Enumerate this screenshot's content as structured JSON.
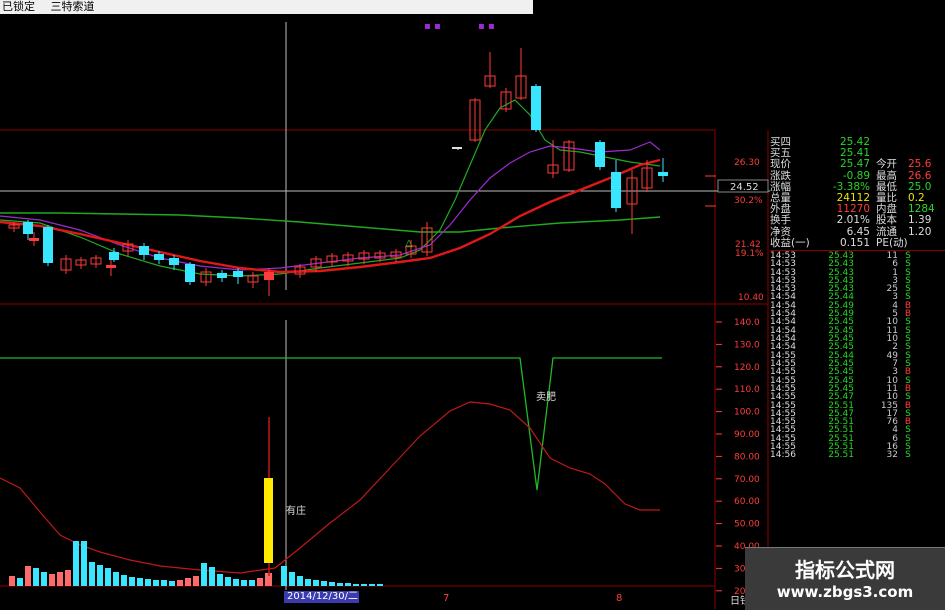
{
  "titlebar": {
    "locked": "已锁定",
    "feature": "三特索道"
  },
  "price_axis": {
    "p1": "26.30",
    "p2": "21.42",
    "p3": "19.1%",
    "p4": "10.40",
    "current": "24.52",
    "pct_hi": "30.2%"
  },
  "indicator_axis": [
    "140.0",
    "130.0",
    "120.0",
    "110.0",
    "100.0",
    "90.00",
    "80.00",
    "70.00",
    "60.00",
    "50.00",
    "40.00",
    "30.00",
    "20.00"
  ],
  "annotations": {
    "sell": "卖肥",
    "buy": "有庄"
  },
  "bottom_date": "2014/12/30/二",
  "bottom_marks": [
    "7",
    "8"
  ],
  "bottom_tab": "日钱",
  "quote_panel": {
    "rows": [
      {
        "l1": "买四",
        "v1": "25.42",
        "c1": "grn"
      },
      {
        "l1": "买五",
        "v1": "25.41",
        "c1": "grn"
      },
      {
        "l1": "现价",
        "v1": "25.47",
        "c1": "grn",
        "l2": "今开",
        "v2": "25.6",
        "c2": "red"
      },
      {
        "l1": "涨跌",
        "v1": "-0.89",
        "c1": "grn",
        "l2": "最高",
        "v2": "26.6",
        "c2": "red"
      },
      {
        "l1": "涨幅",
        "v1": "-3.38%",
        "c1": "grn",
        "l2": "最低",
        "v2": "25.0",
        "c2": "grn"
      },
      {
        "l1": "总量",
        "v1": "24112",
        "c1": "yel",
        "l2": "量比",
        "v2": "0.2",
        "c2": "yel"
      },
      {
        "l1": "外盘",
        "v1": "11270",
        "c1": "red",
        "l2": "内盘",
        "v2": "1284",
        "c2": "grn"
      },
      {
        "l1": "换手",
        "v1": "2.01%",
        "c1": "wht",
        "l2": "股本",
        "v2": "1.39",
        "c2": "wht"
      },
      {
        "l1": "净资",
        "v1": "6.45",
        "c1": "wht",
        "l2": "流通",
        "v2": "1.20",
        "c2": "wht"
      },
      {
        "l1": "收益(一)",
        "v1": "0.151",
        "c1": "wht",
        "l2": "PE(动)",
        "v2": "",
        "c2": "wht"
      }
    ],
    "ticks": [
      [
        "14:53",
        "25.43",
        "11",
        "S"
      ],
      [
        "14:53",
        "25.43",
        "6",
        "S"
      ],
      [
        "14:53",
        "25.43",
        "1",
        "S"
      ],
      [
        "14:53",
        "25.43",
        "3",
        "S"
      ],
      [
        "14:53",
        "25.43",
        "25",
        "S"
      ],
      [
        "14:54",
        "25.44",
        "3",
        "S"
      ],
      [
        "14:54",
        "25.49",
        "4",
        "B"
      ],
      [
        "14:54",
        "25.49",
        "5",
        "B"
      ],
      [
        "14:54",
        "25.45",
        "10",
        "S"
      ],
      [
        "14:54",
        "25.45",
        "11",
        "S"
      ],
      [
        "14:54",
        "25.45",
        "10",
        "S"
      ],
      [
        "14:54",
        "25.45",
        "2",
        "S"
      ],
      [
        "14:55",
        "25.44",
        "49",
        "S"
      ],
      [
        "14:55",
        "25.45",
        "7",
        "S"
      ],
      [
        "14:55",
        "25.45",
        "3",
        "B"
      ],
      [
        "14:55",
        "25.45",
        "10",
        "S"
      ],
      [
        "14:55",
        "25.45",
        "11",
        "B"
      ],
      [
        "14:55",
        "25.47",
        "10",
        "S"
      ],
      [
        "14:55",
        "25.51",
        "135",
        "B"
      ],
      [
        "14:55",
        "25.47",
        "17",
        "S"
      ],
      [
        "14:55",
        "25.51",
        "76",
        "B"
      ],
      [
        "14:55",
        "25.51",
        "4",
        "S"
      ],
      [
        "14:55",
        "25.51",
        "6",
        "S"
      ],
      [
        "14:55",
        "25.51",
        "16",
        "S"
      ],
      [
        "14:56",
        "25.51",
        "32",
        "S"
      ]
    ]
  },
  "watermark": {
    "line1": "指标公式网",
    "line2": "www.zbgs3.com"
  },
  "colors": {
    "up": "#ff3b3b",
    "down": "#38e6ff",
    "ma_red": "#e01818",
    "ma_green": "#1faa1f",
    "ma_purple": "#9d2bd1",
    "indicator": "#c01818",
    "signal": "#22b822"
  }
}
